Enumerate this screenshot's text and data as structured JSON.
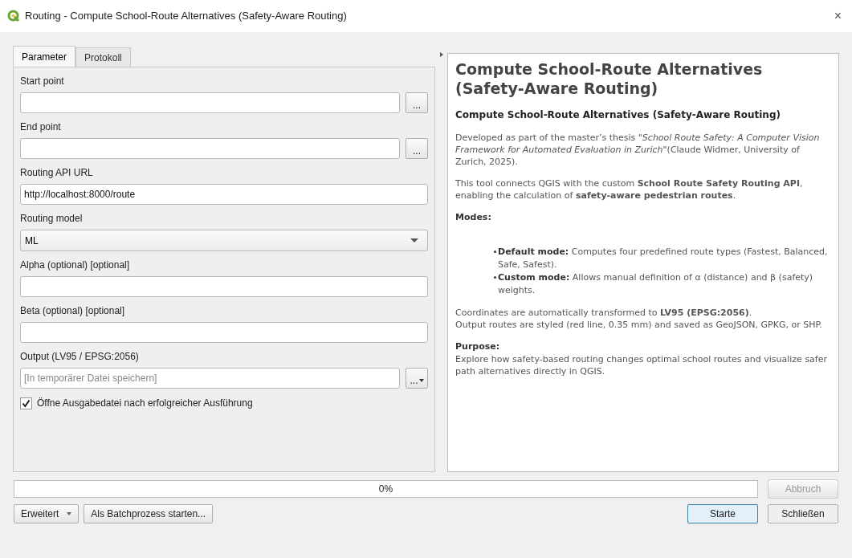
{
  "window": {
    "title": "Routing - Compute School-Route Alternatives (Safety-Aware Routing)",
    "close": "×"
  },
  "tabs": [
    {
      "label": "Parameter",
      "selected": true
    },
    {
      "label": "Protokoll",
      "selected": false
    }
  ],
  "params": [
    {
      "kind": "file",
      "label": "Start point",
      "button": "..."
    },
    {
      "kind": "file",
      "label": "End point",
      "button": "..."
    },
    {
      "kind": "text",
      "label": "Routing API URL",
      "value": "http://localhost:8000/route"
    },
    {
      "kind": "combo",
      "label": "Routing model",
      "value": "ML"
    },
    {
      "kind": "text",
      "label": "Alpha (optional) [optional]"
    },
    {
      "kind": "text",
      "label": "Beta (optional) [optional]"
    },
    {
      "kind": "output",
      "label": "Output (LV95 / EPSG:2056)",
      "placeholder": "[In temporärer Datei speichern]",
      "button": "..."
    },
    {
      "kind": "checkbox",
      "label": "Öffne Ausgabedatei nach erfolgreicher Ausführung",
      "checked": true
    }
  ],
  "help": [
    {
      "kind": "h1",
      "text": "Compute School-Route Alternatives (Safety-Aware Routing)"
    },
    {
      "kind": "h2",
      "text": "Compute School-Route Alternatives (Safety-Aware Routing)"
    },
    {
      "kind": "p",
      "text": "Developed as part of the master’s thesis *\"School Route Safety: A Computer Vision Framework for Automated Evaluation in Zurich\"*(Claude Widmer, University of Zurich, 2025)."
    },
    {
      "kind": "p",
      "text": "This tool connects QGIS with the custom **School Route Safety Routing API**, enabling the calculation of **safety-aware pedestrian routes**."
    },
    {
      "kind": "label",
      "text": "Modes:"
    },
    {
      "kind": "bullets",
      "items": [
        "**Default mode:** Computes four predefined route types (Fastest, Balanced, Safe, Safest).",
        "**Custom mode:** Allows manual definition of α (distance) and β (safety) weights."
      ]
    },
    {
      "kind": "p",
      "text": "Coordinates are automatically transformed to **LV95 (EPSG:2056)**."
    },
    {
      "kind": "pn",
      "text": "Output routes are styled (red line, 0.35 mm) and saved as GeoJSON, GPKG, or SHP."
    },
    {
      "kind": "label",
      "text": "Purpose:"
    },
    {
      "kind": "pn",
      "text": "Explore how safety-based routing changes optimal school routes and visualize safer path alternatives directly in QGIS."
    }
  ],
  "progress": {
    "level": 0,
    "reading": "0%"
  },
  "cancel": {
    "label": "Abbruch",
    "disabled": true
  },
  "buttons_left": [
    {
      "label": "Erweitert",
      "dropdown": true
    },
    {
      "label": "Als Batchprozess starten...",
      "dropdown": false
    }
  ],
  "buttons_right": [
    {
      "label": "Starte",
      "default": true
    },
    {
      "label": "Schließen",
      "default": false
    }
  ]
}
